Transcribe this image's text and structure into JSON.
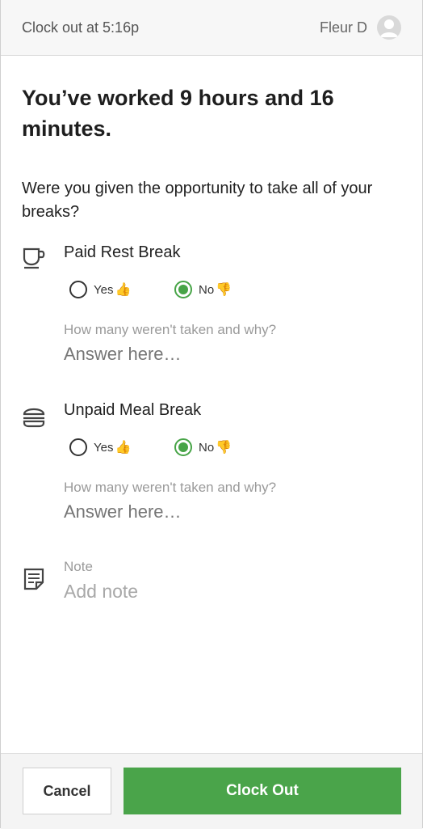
{
  "header": {
    "title": "Clock out at 5:16p",
    "user_name": "Fleur D",
    "avatar_icon": "user-avatar-icon"
  },
  "headline": "You’ve worked 9 hours and 16 minutes.",
  "question": "Were you given the opportunity to take all of your breaks?",
  "sections": [
    {
      "icon": "coffee-cup-icon",
      "title": "Paid Rest Break",
      "yes_label": "Yes",
      "no_label": "No",
      "yes_emoji": "👍",
      "no_emoji": "👎",
      "selected": "no",
      "prompt": "How many weren't taken and why?",
      "answer_placeholder": "Answer here…"
    },
    {
      "icon": "burger-icon",
      "title": "Unpaid Meal Break",
      "yes_label": "Yes",
      "no_label": "No",
      "yes_emoji": "👍",
      "no_emoji": "👎",
      "selected": "no",
      "prompt": "How many weren't taken and why?",
      "answer_placeholder": "Answer here…"
    }
  ],
  "note": {
    "icon": "note-icon",
    "label": "Note",
    "placeholder": "Add note"
  },
  "footer": {
    "cancel_label": "Cancel",
    "clock_out_label": "Clock Out"
  },
  "colors": {
    "accent": "#4aa44a",
    "radio_selected": "#47a447"
  }
}
